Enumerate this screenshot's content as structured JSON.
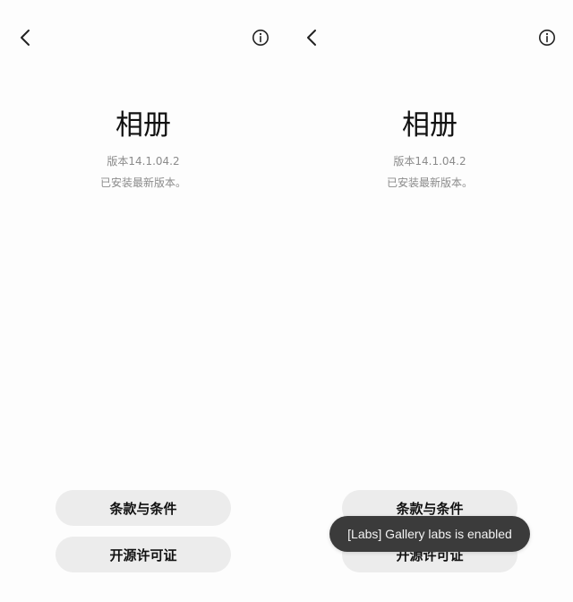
{
  "screens": [
    {
      "back_icon": "chevron-left-icon",
      "info_icon": "info-circle-icon",
      "app_name": "相册",
      "version": "版本14.1.04.2",
      "status": "已安装最新版本。",
      "terms_label": "条款与条件",
      "oss_label": "开源许可证"
    },
    {
      "back_icon": "chevron-left-icon",
      "info_icon": "info-circle-icon",
      "app_name": "相册",
      "version": "版本14.1.04.2",
      "status": "已安装最新版本。",
      "terms_label": "条款与条件",
      "oss_label": "开源许可证",
      "toast": "[Labs] Gallery labs is enabled"
    }
  ],
  "colors": {
    "background": "#fdfdfd",
    "button_bg": "#ececec",
    "secondary_text": "#8b8b8b",
    "toast_bg": "#3b3b3b",
    "toast_text": "#f3f3f3"
  }
}
